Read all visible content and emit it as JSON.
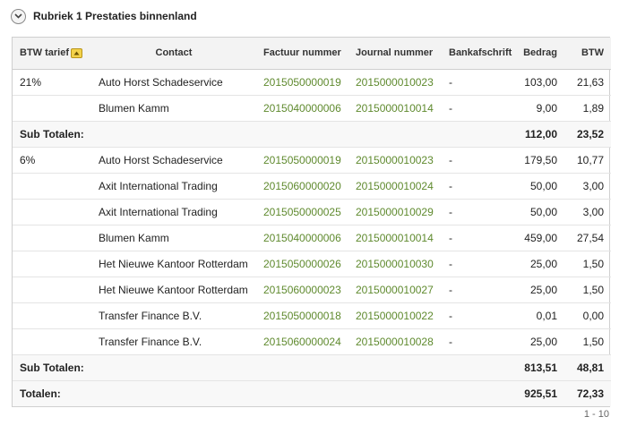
{
  "section": {
    "title": "Rubriek 1 Prestaties binnenland"
  },
  "table": {
    "headers": {
      "btw_tarief": "BTW tarief",
      "contact": "Contact",
      "factuur": "Factuur nummer",
      "journal": "Journal nummer",
      "bank": "Bankafschrift",
      "bedrag": "Bedrag",
      "btw": "BTW"
    },
    "rows": [
      {
        "rate": "21%",
        "contact": "Auto Horst Schadeservice",
        "factuur": "2015050000019",
        "journal": "2015000010023",
        "bank": "-",
        "bedrag": "103,00",
        "btw": "21,63"
      },
      {
        "rate": "",
        "contact": "Blumen Kamm",
        "factuur": "2015040000006",
        "journal": "2015000010014",
        "bank": "-",
        "bedrag": "9,00",
        "btw": "1,89"
      },
      {
        "rate": "6%",
        "contact": "Auto Horst Schadeservice",
        "factuur": "2015050000019",
        "journal": "2015000010023",
        "bank": "-",
        "bedrag": "179,50",
        "btw": "10,77"
      },
      {
        "rate": "",
        "contact": "Axit International Trading",
        "factuur": "2015060000020",
        "journal": "2015000010024",
        "bank": "-",
        "bedrag": "50,00",
        "btw": "3,00"
      },
      {
        "rate": "",
        "contact": "Axit International Trading",
        "factuur": "2015050000025",
        "journal": "2015000010029",
        "bank": "-",
        "bedrag": "50,00",
        "btw": "3,00"
      },
      {
        "rate": "",
        "contact": "Blumen Kamm",
        "factuur": "2015040000006",
        "journal": "2015000010014",
        "bank": "-",
        "bedrag": "459,00",
        "btw": "27,54"
      },
      {
        "rate": "",
        "contact": "Het Nieuwe Kantoor Rotterdam",
        "factuur": "2015050000026",
        "journal": "2015000010030",
        "bank": "-",
        "bedrag": "25,00",
        "btw": "1,50"
      },
      {
        "rate": "",
        "contact": "Het Nieuwe Kantoor Rotterdam",
        "factuur": "2015060000023",
        "journal": "2015000010027",
        "bank": "-",
        "bedrag": "25,00",
        "btw": "1,50"
      },
      {
        "rate": "",
        "contact": "Transfer Finance B.V.",
        "factuur": "2015050000018",
        "journal": "2015000010022",
        "bank": "-",
        "bedrag": "0,01",
        "btw": "0,00"
      },
      {
        "rate": "",
        "contact": "Transfer Finance B.V.",
        "factuur": "2015060000024",
        "journal": "2015000010028",
        "bank": "-",
        "bedrag": "25,00",
        "btw": "1,50"
      }
    ],
    "subtotals": [
      {
        "label": "Sub Totalen:",
        "bedrag": "112,00",
        "btw": "23,52"
      },
      {
        "label": "Sub Totalen:",
        "bedrag": "813,51",
        "btw": "48,81"
      }
    ],
    "total": {
      "label": "Totalen:",
      "bedrag": "925,51",
      "btw": "72,33"
    }
  },
  "pager": {
    "range": "1 - 10"
  },
  "colors": {
    "link_green": "#5f8a2e",
    "sort_yellow": "#f3d24a"
  },
  "icons": {
    "collapse": "chevron-down-circle-icon",
    "sort": "sort-up-icon"
  }
}
